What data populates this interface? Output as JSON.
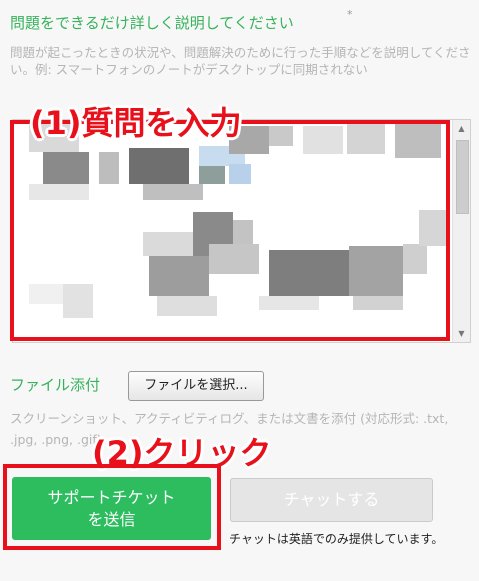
{
  "question": {
    "title": "問題をできるだけ詳しく説明してください",
    "required_mark": "*",
    "hint": "問題が起こったときの状況や、問題解決のために行った手順などを説明してください。例: スマートフォンのノートがデスクトップに同期されない"
  },
  "annotations": {
    "step1": "(1)質問を入力",
    "step2": "(2)クリック",
    "color": "#e8101a"
  },
  "attachment": {
    "label": "ファイル添付",
    "button": "ファイルを選択...",
    "hint": "スクリーンショット、アクティビティログ、または文書を添付 (対応形式: .txt, .jpg, .png, .gif)"
  },
  "actions": {
    "submit": "サポートチケット\nを送信",
    "chat": "チャットする",
    "chat_note": "チャットは英語でのみ提供しています。"
  },
  "colors": {
    "accent_green": "#36b35b",
    "submit_green": "#2dbd5f",
    "disabled_gray": "#e5e5e5"
  },
  "icons": {
    "scroll_up": "scroll-up-arrow-icon",
    "scroll_down": "scroll-down-arrow-icon"
  }
}
